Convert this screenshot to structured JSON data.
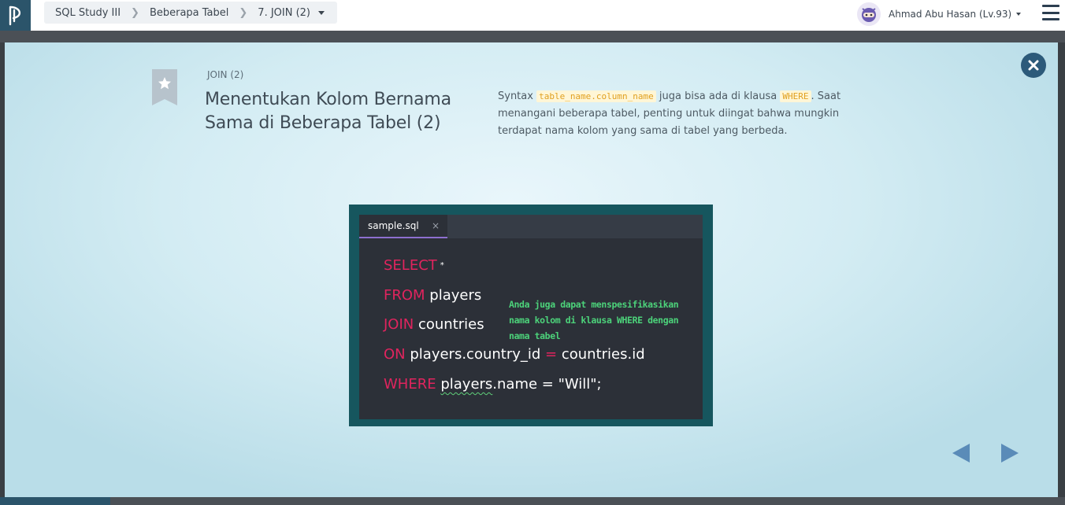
{
  "breadcrumb": {
    "course": "SQL Study III",
    "chapter": "Beberapa Tabel",
    "lesson": "7. JOIN (2)"
  },
  "user": {
    "name": "Ahmad Abu Hasan (Lv.93)"
  },
  "slide": {
    "chapter_label": "JOIN (2)",
    "title": "Menentukan Kolom Bernama Sama di Beberapa Tabel (2)",
    "desc": {
      "part1": "Syntax ",
      "code1": "table_name.column_name",
      "part2": " juga bisa ada di klausa ",
      "code2": "WHERE",
      "part3": ". Saat menangani beberapa tabel, penting untuk diingat bahwa mungkin terdapat nama kolom yang sama di tabel yang berbeda."
    }
  },
  "editor": {
    "tab_label": "sample.sql",
    "tab_close": "×",
    "lines": {
      "l1": {
        "kw": "SELECT",
        "rest": "*"
      },
      "l2": {
        "kw": "FROM",
        "rest": " players"
      },
      "l3": {
        "kw": "JOIN",
        "rest": " countries"
      },
      "l4": {
        "kw": "ON",
        "rest_a": " players.country_id ",
        "op": "=",
        "rest_b": " countries.id"
      },
      "l5": {
        "kw": "WHERE",
        "squiggle": "players",
        "rest": ".name = \"Will\";"
      }
    },
    "annotation": "Anda juga dapat menspesifikasikan nama kolom di klausa WHERE dengan nama tabel"
  },
  "colors": {
    "keyword": "#e0245e",
    "annotation": "#4cd27a",
    "accent": "#2c5a7a"
  }
}
